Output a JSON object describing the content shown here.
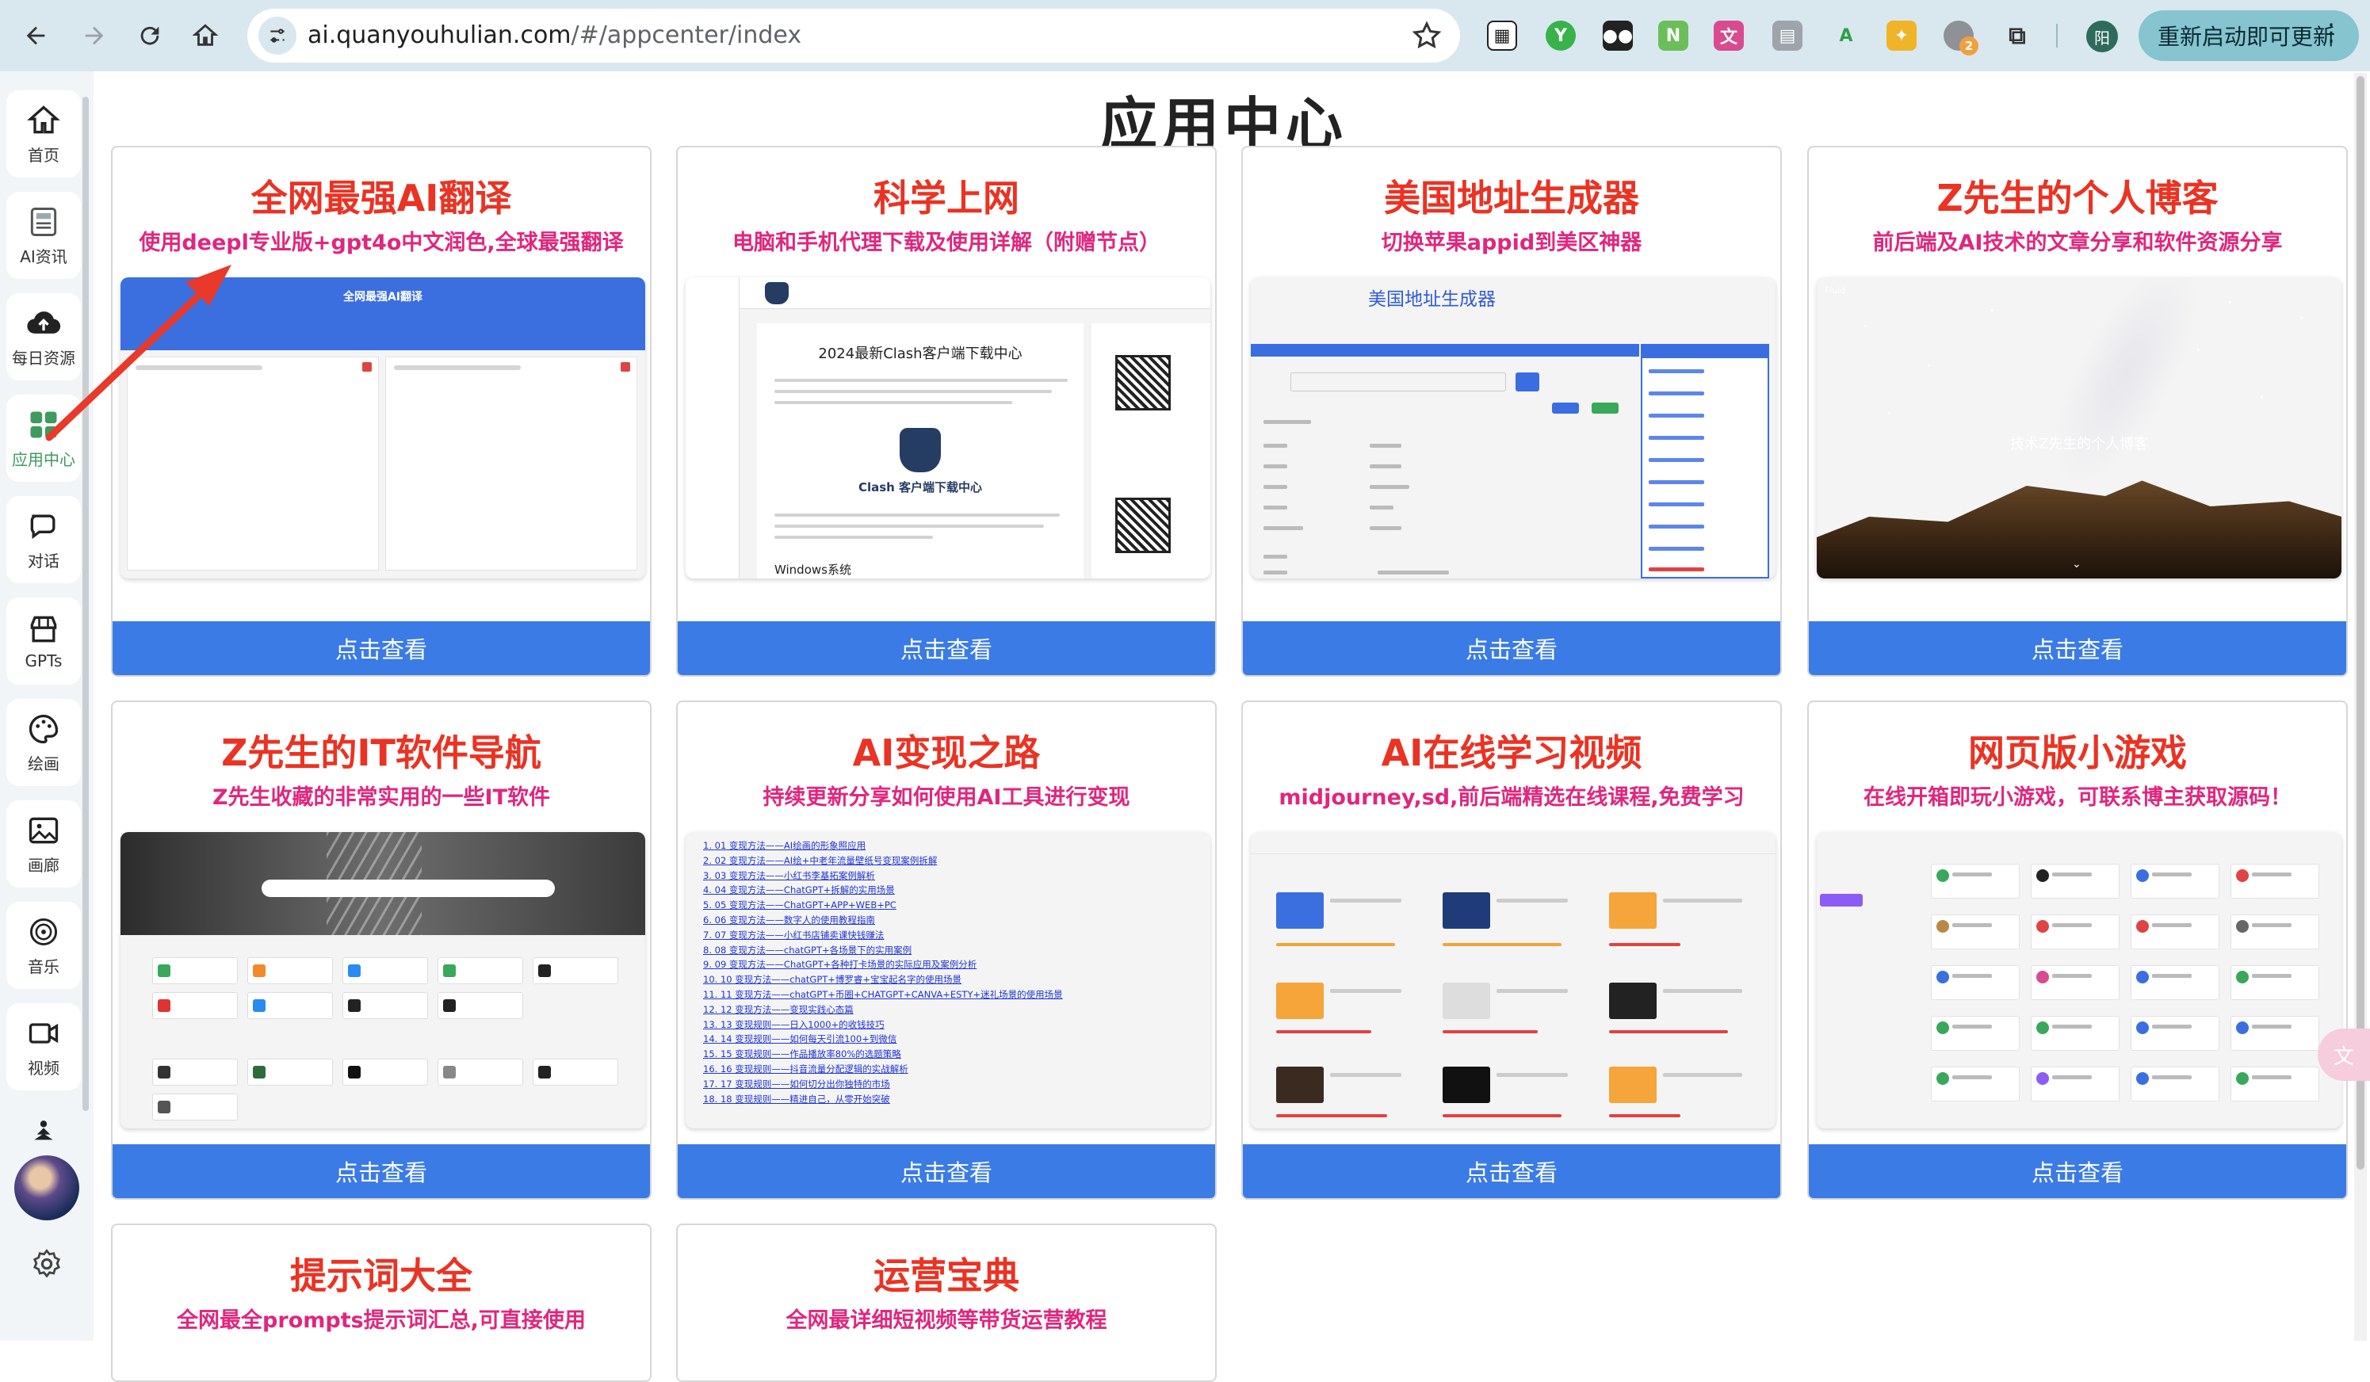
{
  "browser": {
    "url_host": "ai.quanyouhulian.com",
    "url_path": "/#/appcenter/index",
    "update_label": "重新启动即可更新",
    "profile_initial": "阳",
    "ext_badge": "2"
  },
  "sidebar": {
    "items": [
      {
        "label": "首页",
        "icon": "home-icon"
      },
      {
        "label": "AI资讯",
        "icon": "news-icon"
      },
      {
        "label": "每日资源",
        "icon": "cloud-upload-icon"
      },
      {
        "label": "应用中心",
        "icon": "apps-grid-icon",
        "active": true
      },
      {
        "label": "对话",
        "icon": "chat-icon"
      },
      {
        "label": "GPTs",
        "icon": "store-icon"
      },
      {
        "label": "绘画",
        "icon": "palette-icon"
      },
      {
        "label": "画廊",
        "icon": "gallery-icon"
      },
      {
        "label": "音乐",
        "icon": "music-icon"
      },
      {
        "label": "视频",
        "icon": "video-icon"
      }
    ]
  },
  "page": {
    "title": "应用中心",
    "cards": [
      {
        "title": "全网最强AI翻译",
        "subtitle": "使用deepl专业版+gpt4o中文润色,全球最强翻译",
        "button": "点击查看"
      },
      {
        "title": "科学上网",
        "subtitle": "电脑和手机代理下载及使用详解（附赠节点）",
        "button": "点击查看"
      },
      {
        "title": "美国地址生成器",
        "subtitle": "切换苹果appid到美区神器",
        "button": "点击查看"
      },
      {
        "title": "Z先生的个人博客",
        "subtitle": "前后端及AI技术的文章分享和软件资源分享",
        "button": "点击查看"
      },
      {
        "title": "Z先生的IT软件导航",
        "subtitle": "Z先生收藏的非常实用的一些IT软件",
        "button": "点击查看"
      },
      {
        "title": "AI变现之路",
        "subtitle": "持续更新分享如何使用AI工具进行变现",
        "button": "点击查看"
      },
      {
        "title": "AI在线学习视频",
        "subtitle": "midjourney,sd,前后端精选在线课程,免费学习",
        "button": "点击查看"
      },
      {
        "title": "网页版小游戏",
        "subtitle": "在线开箱即玩小游戏，可联系博主获取源码！",
        "button": "点击查看"
      },
      {
        "title": "提示词大全",
        "subtitle": "全网最全prompts提示词汇总,可直接使用",
        "button": "点击查看"
      },
      {
        "title": "运营宝典",
        "subtitle": "全网最详细短视频等带货运营教程",
        "button": "点击查看"
      }
    ]
  },
  "previews": {
    "translate_title": "全网最强AI翻译",
    "clash_heading": "2024最新Clash客户端下载中心",
    "clash_caption": "Clash 客户端下载中心",
    "clash_section": "Windows系统",
    "address_heading": "美国地址生成器",
    "blog_caption": "技术Z先生的个人博客",
    "blog_logo": "Fluid",
    "list_items": [
      "01 变现方法——AI绘画的形象照应用",
      "02 变现方法——AI绘+中老年流量壁纸号变现案例拆解",
      "03 变现方法——小红书李基拓案例解析",
      "04 变现方法——ChatGPT+拆解的实用场景",
      "05 变现方法——ChatGPT+APP+WEB+PC",
      "06 变现方法——数字人的使用教程指南",
      "07 变现方法——小红书店铺卖课快钱赚法",
      "08 变现方法——chatGPT+各场景下的实用案例",
      "09 变现方法——ChatGPT+各种打卡场景的实际应用及案例分析",
      "10 变现方法——chatGPT+博罗睿+宝宝起名字的使用场景",
      "11 变现方法——chatGPT+币圈+CHATGPT+CANVA+ESTY+迷礼场景的使用场景",
      "12 变现方法——变现实践心态篇",
      "13 变现规则——日入1000+的收钱技巧",
      "14 变现规则——如何每天引流100+到微信",
      "15 变现规则——作品播放率80%的选题策略",
      "16 变现规则——抖音流量分配逻辑的实战解析",
      "17 变现规则——如何切分出你独特的市场",
      "18 变现规则——精进自己，从零开始突破"
    ]
  },
  "colors": {
    "title_red": "#ea3323",
    "subtitle_pink": "#e0267e",
    "button_blue": "#3b7be5",
    "active_green": "#3e9a5d",
    "arrow_red": "#e8392b"
  }
}
